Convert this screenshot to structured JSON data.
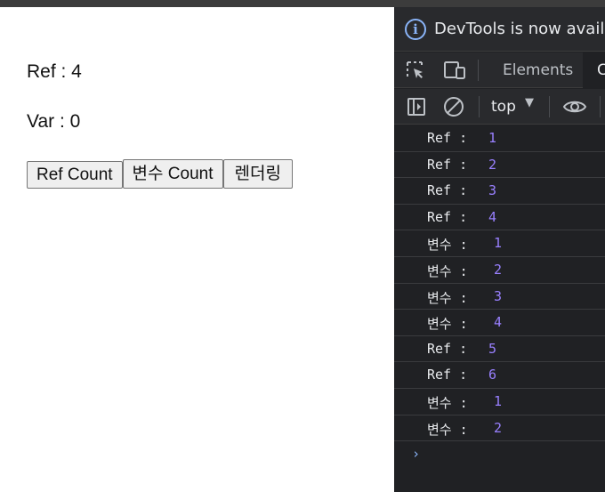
{
  "page": {
    "ref_text": "Ref : 4",
    "var_text": "Var : 0",
    "buttons": {
      "ref_count": "Ref Count",
      "var_count": "변수 Count",
      "render": "렌더링"
    }
  },
  "devtools": {
    "info_banner": "DevTools is now available",
    "tabs": {
      "elements": "Elements",
      "console": "C"
    },
    "context": "top",
    "context_arrow": "▼",
    "console_logs": [
      {
        "label": "Ref :",
        "value": "1"
      },
      {
        "label": "Ref :",
        "value": "2"
      },
      {
        "label": "Ref :",
        "value": "3"
      },
      {
        "label": "Ref :",
        "value": "4"
      },
      {
        "label": "변수 :",
        "value": "1"
      },
      {
        "label": "변수 :",
        "value": "2"
      },
      {
        "label": "변수 :",
        "value": "3"
      },
      {
        "label": "변수 :",
        "value": "4"
      },
      {
        "label": "Ref :",
        "value": "5"
      },
      {
        "label": "Ref :",
        "value": "6"
      },
      {
        "label": "변수 :",
        "value": "1"
      },
      {
        "label": "변수 :",
        "value": "2"
      }
    ],
    "prompt": "›",
    "colors": {
      "panel_bg": "#202124",
      "toolbar_bg": "#292a2d",
      "number_color": "#9980ff",
      "accent_blue": "#8ab4f8"
    }
  }
}
